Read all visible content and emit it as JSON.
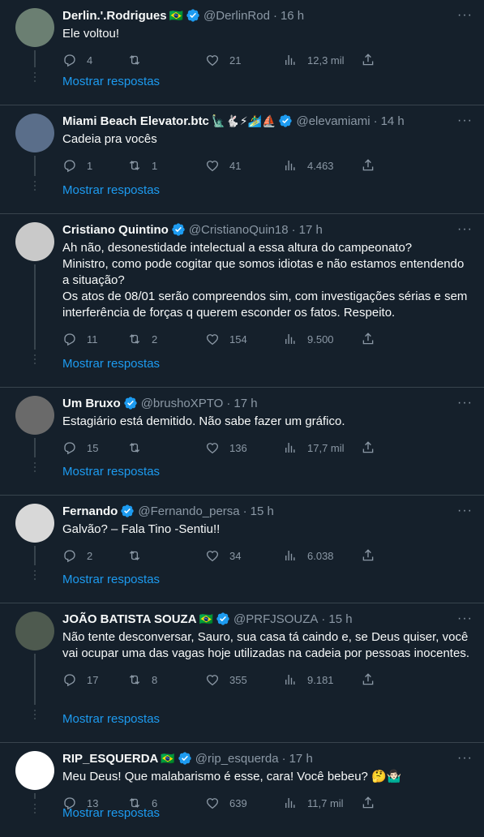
{
  "tweets": [
    {
      "name": "Derlin.'.Rodrigues",
      "emoji": "🇧🇷",
      "handle": "@DerlinRod",
      "time": "16 h",
      "text": "Ele voltou!",
      "replies": "4",
      "retweets": "",
      "likes": "21",
      "views": "12,3 mil",
      "show_replies": "Mostrar respostas",
      "avatar_color": "#6b7f72"
    },
    {
      "name": "Miami Beach Elevator.btc",
      "emoji": "🗽🐇⚡🏄‍♂️⛵",
      "handle": "@elevamiami",
      "time": "14 h",
      "text": "Cadeia pra vocês",
      "replies": "1",
      "retweets": "1",
      "likes": "41",
      "views": "4.463",
      "show_replies": "Mostrar respostas",
      "avatar_color": "#5a6e8a"
    },
    {
      "name": "Cristiano Quintino",
      "emoji": "",
      "handle": "@CristianoQuin18",
      "time": "17 h",
      "text": "Ah não, desonestidade intelectual a essa altura do campeonato?\nMinistro, como pode cogitar que somos idiotas e não estamos entendendo a situação?\nOs atos de 08/01 serão compreendos sim, com investigações sérias e sem interferência de forças q querem esconder os fatos. Respeito.",
      "replies": "11",
      "retweets": "2",
      "likes": "154",
      "views": "9.500",
      "show_replies": "Mostrar respostas",
      "avatar_color": "#c9c9c9"
    },
    {
      "name": "Um Bruxo",
      "emoji": "",
      "handle": "@brushoXPTO",
      "time": "17 h",
      "text": "Estagiário está demitido. Não sabe fazer um gráfico.",
      "replies": "15",
      "retweets": "",
      "likes": "136",
      "views": "17,7 mil",
      "show_replies": "Mostrar respostas",
      "avatar_color": "#6a6a6a"
    },
    {
      "name": "Fernando",
      "emoji": "",
      "handle": "@Fernando_persa",
      "time": "15 h",
      "text": "Galvão? – Fala Tino -Sentiu!!",
      "replies": "2",
      "retweets": "",
      "likes": "34",
      "views": "6.038",
      "show_replies": "Mostrar respostas",
      "avatar_color": "#d8d8d8"
    },
    {
      "name": "JOÃO BATISTA SOUZA",
      "emoji": "🇧🇷",
      "handle": "@PRFJSOUZA",
      "time": "15 h",
      "text": "Não tente desconversar, Sauro, sua casa tá caindo e, se Deus quiser, você vai ocupar uma das vagas hoje utilizadas na cadeia por pessoas inocentes.",
      "replies": "17",
      "retweets": "8",
      "likes": "355",
      "views": "9.181",
      "show_replies": "Mostrar respostas",
      "avatar_color": "#4e5a4f"
    },
    {
      "name": "RIP_ESQUERDA",
      "emoji": "🇧🇷",
      "handle": "@rip_esquerda",
      "time": "17 h",
      "text": "Meu Deus! Que malabarismo é esse, cara! Você bebeu? 🤔🤷🏻‍♂️",
      "replies": "13",
      "retweets": "6",
      "likes": "639",
      "views": "11,7 mil",
      "show_replies": "Mostrar respostas",
      "avatar_color": "#ffffff"
    }
  ],
  "more_label": "···",
  "colors": {
    "bg": "#15202b",
    "link": "#1d9bf0",
    "muted": "#8b98a5",
    "verified": "#1d9bf0"
  }
}
